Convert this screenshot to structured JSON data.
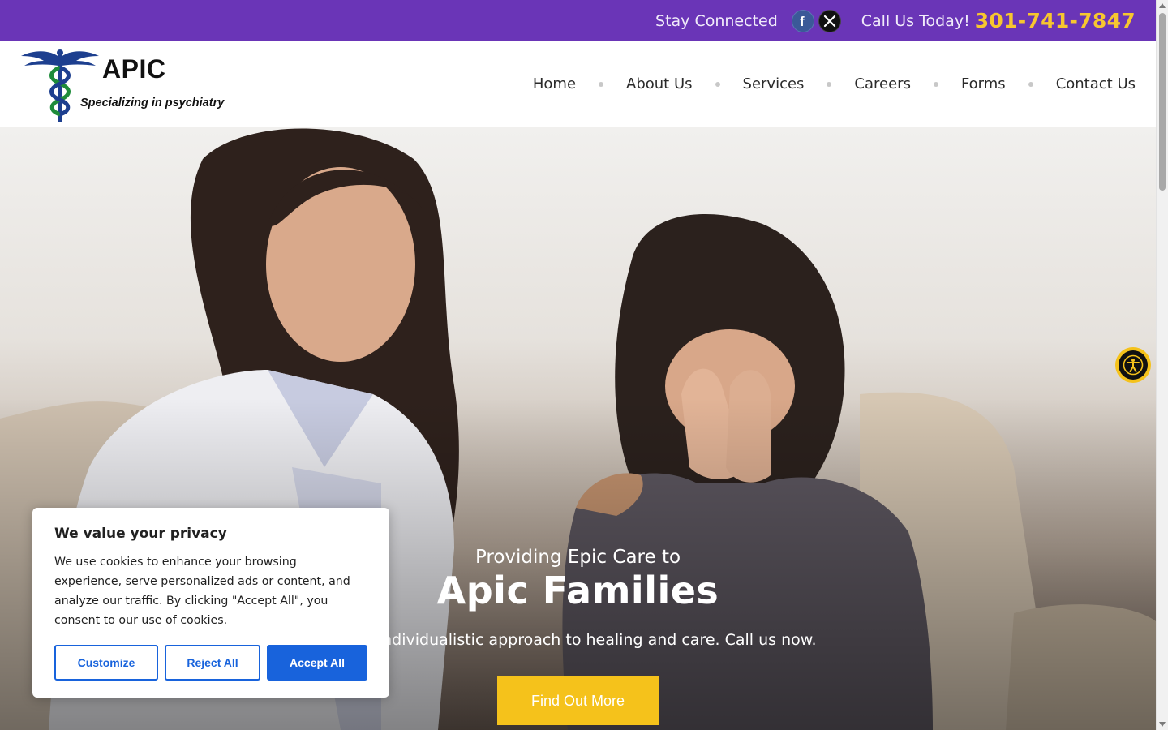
{
  "topbar": {
    "stay_connected": "Stay Connected",
    "social": [
      {
        "icon": "facebook-icon",
        "glyph": "f"
      },
      {
        "icon": "x-twitter-icon",
        "glyph": "𝕏"
      }
    ],
    "call_label": "Call Us Today!",
    "phone": "301-741-7847",
    "colors": {
      "bar": "#6a35b7",
      "phone": "#f7c62f"
    }
  },
  "logo": {
    "name": "APIC",
    "tagline": "Specializing in psychiatry",
    "icon": "caduceus-icon"
  },
  "nav": {
    "items": [
      {
        "label": "Home",
        "active": true
      },
      {
        "label": "About Us"
      },
      {
        "label": "Services"
      },
      {
        "label": "Careers"
      },
      {
        "label": "Forms"
      },
      {
        "label": "Contact Us"
      }
    ]
  },
  "hero": {
    "pre_title": "Providing Epic Care to",
    "title": "Apic Families",
    "subtitle": "e an individualistic approach to healing and care. Call us now.",
    "cta_label": "Find Out More",
    "cta_color": "#f5c21b"
  },
  "accessibility": {
    "icon": "accessibility-icon"
  },
  "cookie": {
    "title": "We value your privacy",
    "text": "We use cookies to enhance your browsing experience, serve personalized ads or content, and analyze our traffic. By clicking \"Accept All\", you consent to our use of cookies.",
    "customize": "Customize",
    "reject": "Reject All",
    "accept": "Accept All",
    "accent": "#1863dc"
  }
}
